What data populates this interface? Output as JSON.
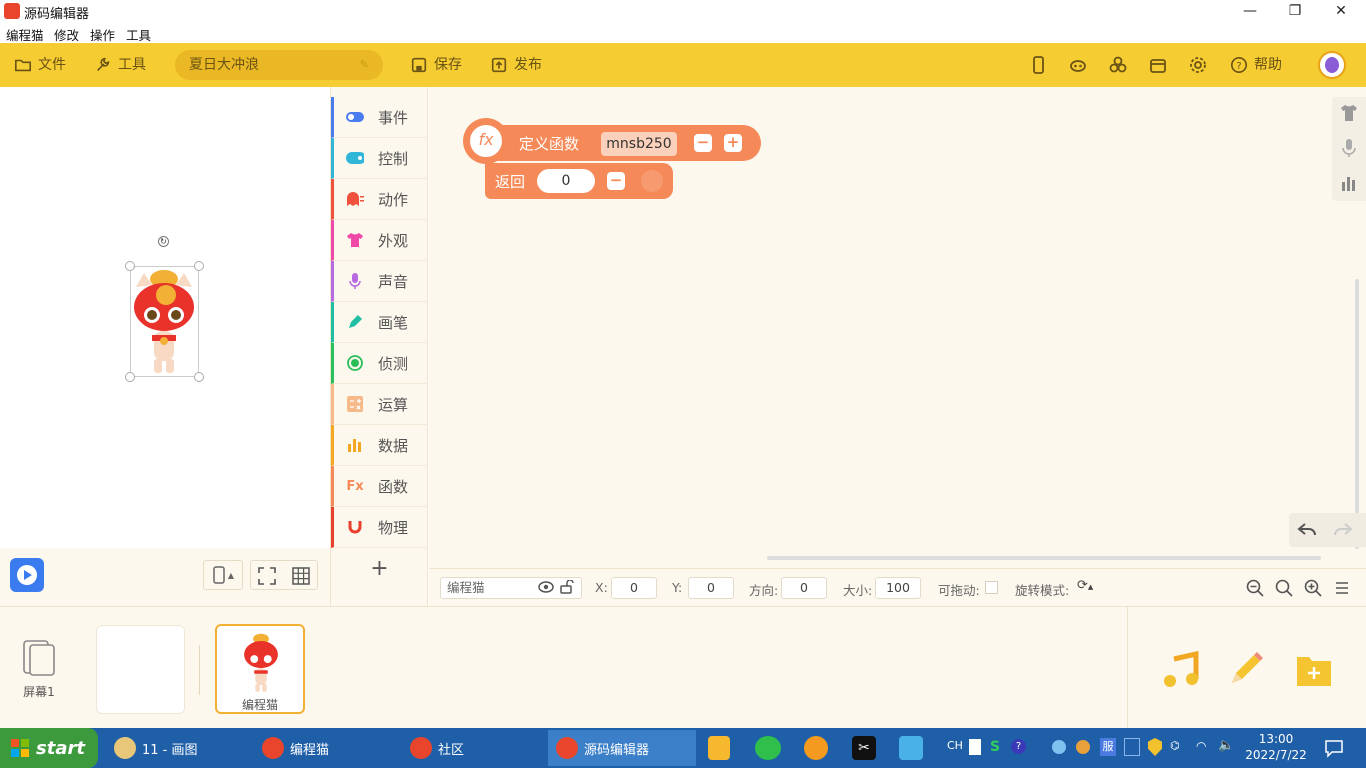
{
  "window": {
    "title": "源码编辑器",
    "minimize": "—",
    "restore": "❐",
    "close": "✕"
  },
  "menu": [
    "编程猫",
    "修改",
    "操作",
    "工具"
  ],
  "toolbar": {
    "file": "文件",
    "tools": "工具",
    "project_name": "夏日大冲浪",
    "save": "保存",
    "publish": "发布",
    "help": "帮助"
  },
  "categories": [
    {
      "label": "事件",
      "color": "#4a7cf0"
    },
    {
      "label": "控制",
      "color": "#31b6d8"
    },
    {
      "label": "动作",
      "color": "#f0523d"
    },
    {
      "label": "外观",
      "color": "#f04aa8"
    },
    {
      "label": "声音",
      "color": "#b86ae0"
    },
    {
      "label": "画笔",
      "color": "#20bfa3"
    },
    {
      "label": "侦测",
      "color": "#2bbf5a"
    },
    {
      "label": "运算",
      "color": "#f5b98a"
    },
    {
      "label": "数据",
      "color": "#f5a623"
    },
    {
      "label": "函数",
      "color": "#f58a58"
    },
    {
      "label": "物理",
      "color": "#e8402c"
    }
  ],
  "add_extension": "+",
  "blocks": {
    "define_label": "定义函数",
    "function_name": "mnsb250",
    "return_label": "返回",
    "return_value": "0",
    "fx": "fx",
    "minus": "−",
    "plus": "+"
  },
  "props": {
    "sprite_name": "编程猫",
    "x_label": "X:",
    "x": "0",
    "y_label": "Y:",
    "y": "0",
    "dir_label": "方向:",
    "dir": "0",
    "size_label": "大小:",
    "size": "100",
    "drag_label": "可拖动:",
    "rot_label": "旋转模式:"
  },
  "sprites": {
    "screen_label": "屏幕1",
    "sprite_label": "编程猫"
  },
  "taskbar": {
    "start": "start",
    "tasks": [
      "11 - 画图",
      "编程猫",
      "社区",
      "源码编辑器"
    ],
    "tray_lang": "CH",
    "tray_input": "服",
    "time": "13:00",
    "date": "2022/7/22"
  },
  "colors": {
    "toolbar": "#f6cc33",
    "block": "#f58a58",
    "taskbar": "#1f5fa8"
  }
}
